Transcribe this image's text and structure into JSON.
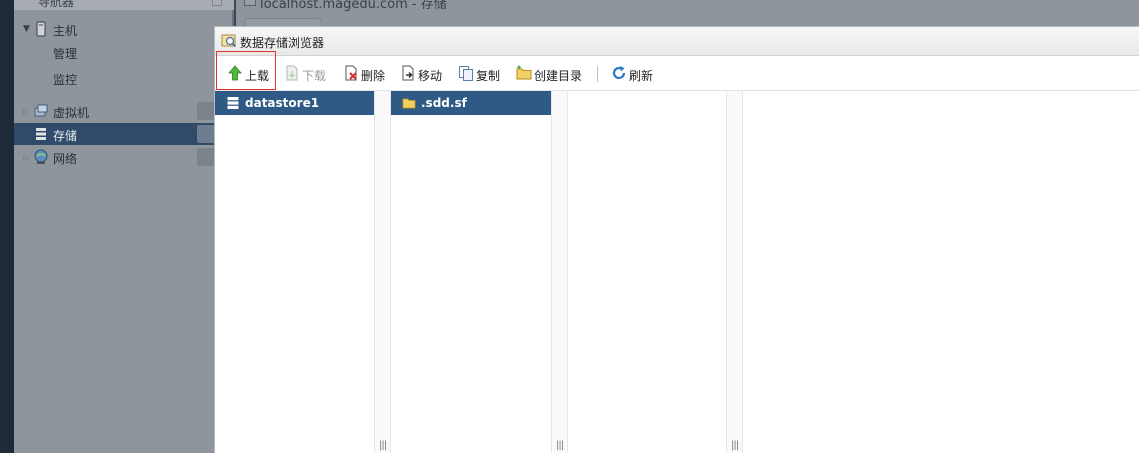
{
  "navigator": {
    "header_label": "导航器",
    "host": {
      "label": "主机",
      "children": [
        "管理",
        "监控"
      ]
    },
    "items": [
      {
        "label": "虚拟机"
      },
      {
        "label": "存储"
      },
      {
        "label": "网络"
      }
    ]
  },
  "background": {
    "page_title": "localhost.magedu.com - 存储"
  },
  "dialog": {
    "title": "数据存储浏览器",
    "toolbar": {
      "upload": "上载",
      "download": "下载",
      "delete": "删除",
      "move": "移动",
      "copy": "复制",
      "create_dir": "创建目录",
      "refresh": "刷新"
    },
    "columns": [
      {
        "selected": "datastore1",
        "icon": "datastore-icon"
      },
      {
        "selected": ".sdd.sf",
        "icon": "folder-icon"
      },
      {
        "selected": null
      },
      {
        "selected": null
      }
    ],
    "column_grip": "|||"
  },
  "colors": {
    "selection": "#2f5a85",
    "highlight_border": "#e0332f",
    "nav_selected": "#2f4b69"
  }
}
